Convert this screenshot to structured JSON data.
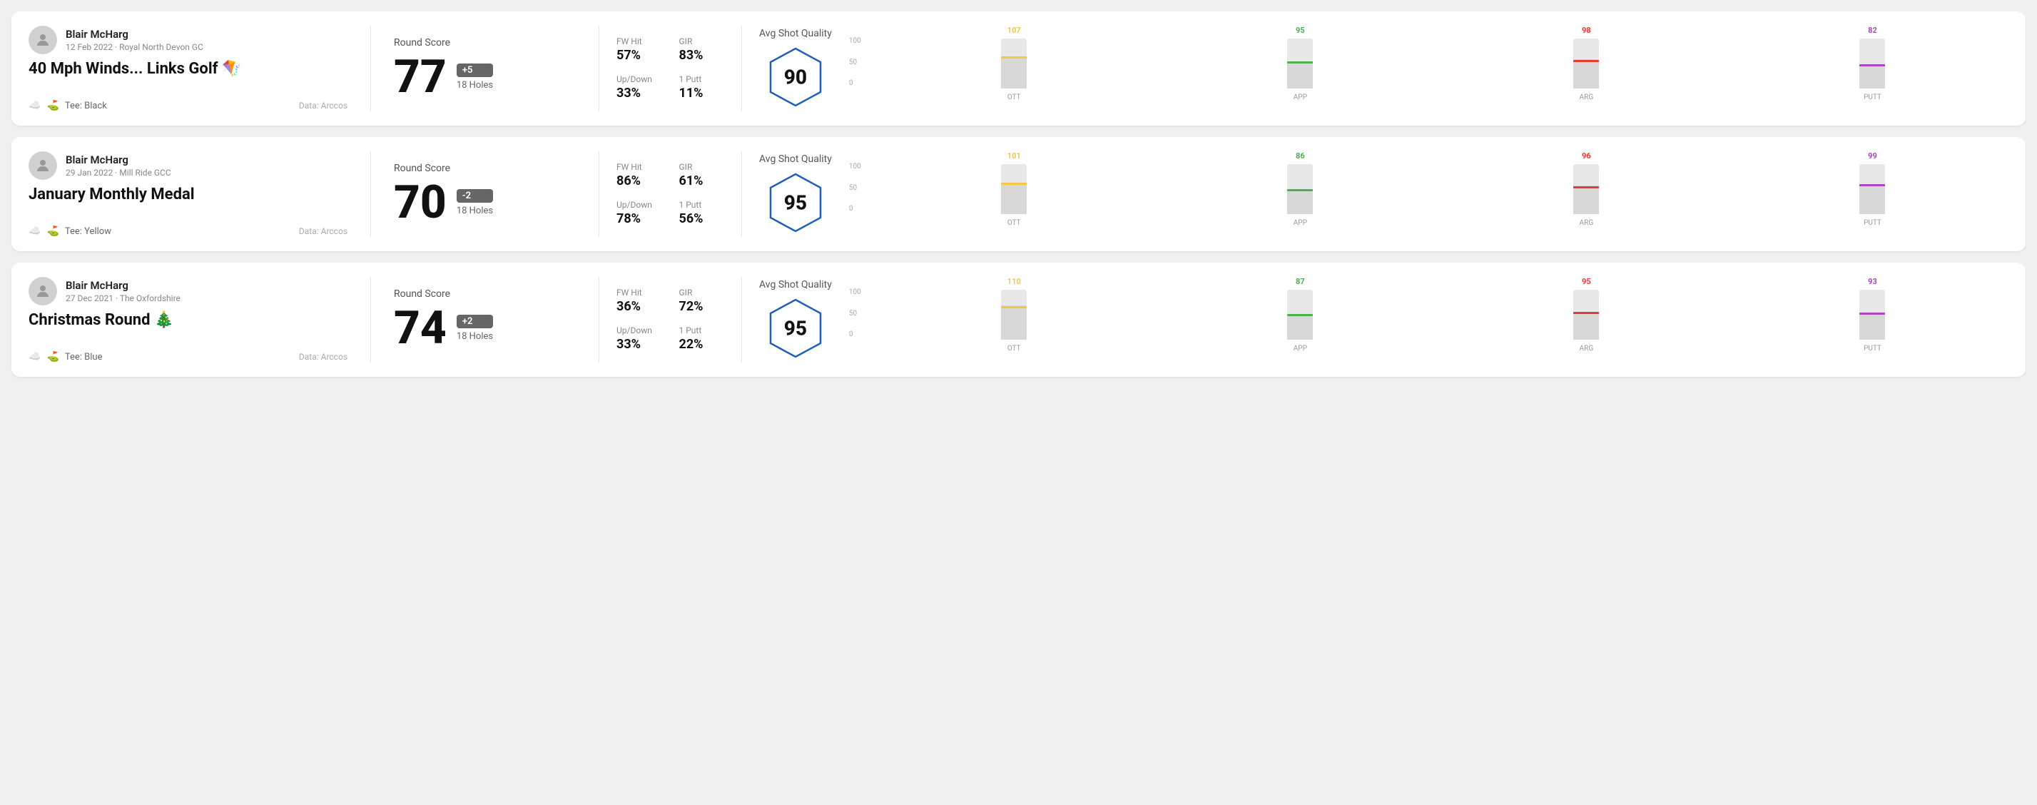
{
  "rounds": [
    {
      "id": "round-1",
      "player": {
        "name": "Blair McHarg",
        "date": "12 Feb 2022",
        "course": "Royal North Devon GC"
      },
      "title": "40 Mph Winds... Links Golf 🪁",
      "tee": "Black",
      "data_source": "Data: Arccos",
      "score": {
        "label": "Round Score",
        "number": "77",
        "badge": "+5",
        "badge_type": "positive",
        "holes": "18 Holes"
      },
      "stats": {
        "fw_hit_label": "FW Hit",
        "fw_hit_value": "57%",
        "gir_label": "GIR",
        "gir_value": "83%",
        "updown_label": "Up/Down",
        "updown_value": "33%",
        "one_putt_label": "1 Putt",
        "one_putt_value": "11%"
      },
      "avg_shot": {
        "label": "Avg Shot Quality",
        "score": "90"
      },
      "chart": {
        "bars": [
          {
            "label": "OTT",
            "top_value": "107",
            "height_pct": 65,
            "marker_color": "#f5c842",
            "marker_pct": 60
          },
          {
            "label": "APP",
            "top_value": "95",
            "height_pct": 55,
            "marker_color": "#4caf50",
            "marker_pct": 50
          },
          {
            "label": "ARG",
            "top_value": "98",
            "height_pct": 58,
            "marker_color": "#e53935",
            "marker_pct": 53
          },
          {
            "label": "PUTT",
            "top_value": "82",
            "height_pct": 48,
            "marker_color": "#ab47bc",
            "marker_pct": 44
          }
        ],
        "y_labels": [
          "100",
          "50",
          "0"
        ]
      }
    },
    {
      "id": "round-2",
      "player": {
        "name": "Blair McHarg",
        "date": "29 Jan 2022",
        "course": "Mill Ride GCC"
      },
      "title": "January Monthly Medal",
      "tee": "Yellow",
      "data_source": "Data: Arccos",
      "score": {
        "label": "Round Score",
        "number": "70",
        "badge": "-2",
        "badge_type": "negative",
        "holes": "18 Holes"
      },
      "stats": {
        "fw_hit_label": "FW Hit",
        "fw_hit_value": "86%",
        "gir_label": "GIR",
        "gir_value": "61%",
        "updown_label": "Up/Down",
        "updown_value": "78%",
        "one_putt_label": "1 Putt",
        "one_putt_value": "56%"
      },
      "avg_shot": {
        "label": "Avg Shot Quality",
        "score": "95"
      },
      "chart": {
        "bars": [
          {
            "label": "OTT",
            "top_value": "101",
            "height_pct": 63,
            "marker_color": "#f5c842",
            "marker_pct": 58
          },
          {
            "label": "APP",
            "top_value": "86",
            "height_pct": 50,
            "marker_color": "#4caf50",
            "marker_pct": 46
          },
          {
            "label": "ARG",
            "top_value": "96",
            "height_pct": 57,
            "marker_color": "#e53935",
            "marker_pct": 52
          },
          {
            "label": "PUTT",
            "top_value": "99",
            "height_pct": 60,
            "marker_color": "#ab47bc",
            "marker_pct": 56
          }
        ],
        "y_labels": [
          "100",
          "50",
          "0"
        ]
      }
    },
    {
      "id": "round-3",
      "player": {
        "name": "Blair McHarg",
        "date": "27 Dec 2021",
        "course": "The Oxfordshire"
      },
      "title": "Christmas Round 🎄",
      "tee": "Blue",
      "data_source": "Data: Arccos",
      "score": {
        "label": "Round Score",
        "number": "74",
        "badge": "+2",
        "badge_type": "positive",
        "holes": "18 Holes"
      },
      "stats": {
        "fw_hit_label": "FW Hit",
        "fw_hit_value": "36%",
        "gir_label": "GIR",
        "gir_value": "72%",
        "updown_label": "Up/Down",
        "updown_value": "33%",
        "one_putt_label": "1 Putt",
        "one_putt_value": "22%"
      },
      "avg_shot": {
        "label": "Avg Shot Quality",
        "score": "95"
      },
      "chart": {
        "bars": [
          {
            "label": "OTT",
            "top_value": "110",
            "height_pct": 68,
            "marker_color": "#f5c842",
            "marker_pct": 63
          },
          {
            "label": "APP",
            "top_value": "87",
            "height_pct": 51,
            "marker_color": "#4caf50",
            "marker_pct": 47
          },
          {
            "label": "ARG",
            "top_value": "95",
            "height_pct": 56,
            "marker_color": "#e53935",
            "marker_pct": 52
          },
          {
            "label": "PUTT",
            "top_value": "93",
            "height_pct": 55,
            "marker_color": "#ab47bc",
            "marker_pct": 50
          }
        ],
        "y_labels": [
          "100",
          "50",
          "0"
        ]
      }
    }
  ]
}
